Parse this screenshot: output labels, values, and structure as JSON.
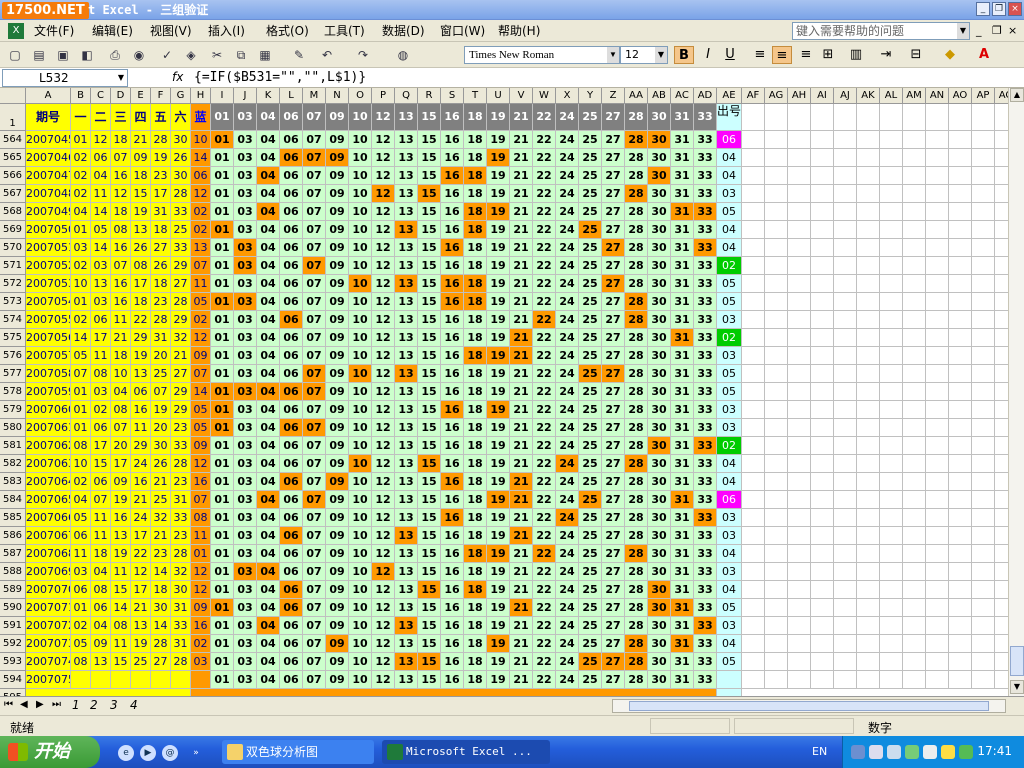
{
  "title": {
    "logo": "17500.NET",
    "text": "t Excel - 三组验证"
  },
  "menu": {
    "items": [
      "文件(F)",
      "编辑(E)",
      "视图(V)",
      "插入(I)",
      "格式(O)",
      "工具(T)",
      "数据(D)",
      "窗口(W)",
      "帮助(H)"
    ],
    "help_placeholder": "键入需要帮助的问题"
  },
  "toolbar": {
    "font": "Times New Roman",
    "size": "12"
  },
  "formula": {
    "cell": "L532",
    "fx": "fx",
    "text": "{=IF($B531=\"\",\"\",L$1)}"
  },
  "grid": {
    "cols": [
      "A",
      "B",
      "C",
      "D",
      "E",
      "F",
      "G",
      "H",
      "I",
      "J",
      "K",
      "L",
      "M",
      "N",
      "O",
      "P",
      "Q",
      "R",
      "S",
      "T",
      "U",
      "V",
      "W",
      "X",
      "Y",
      "Z",
      "AA",
      "AB",
      "AC",
      "AD",
      "AE",
      "AF",
      "AG",
      "AH",
      "AI",
      "AJ",
      "AK",
      "AL",
      "AM",
      "AN",
      "AO",
      "AP",
      "AQ"
    ],
    "header_row": {
      "num": "1",
      "a": "期号",
      "b": [
        "一",
        "二",
        "三",
        "四",
        "五",
        "六"
      ],
      "h": "蓝",
      "nums": [
        "01",
        "03",
        "04",
        "06",
        "07",
        "09",
        "10",
        "12",
        "13",
        "15",
        "16",
        "18",
        "19",
        "21",
        "22",
        "24",
        "25",
        "27",
        "28",
        "30",
        "31",
        "33"
      ],
      "ae": "出号"
    },
    "rows": [
      {
        "r": "564",
        "a": "2007045",
        "b": [
          "01",
          "12",
          "18",
          "21",
          "28",
          "30"
        ],
        "h": "10",
        "o": [
          "01",
          "28",
          "30"
        ],
        "ae": "06",
        "aec": "m"
      },
      {
        "r": "565",
        "a": "2007046",
        "b": [
          "02",
          "06",
          "07",
          "09",
          "19",
          "26"
        ],
        "h": "14",
        "o": [
          "06",
          "07",
          "09",
          "19"
        ],
        "ae": "04",
        "aec": ""
      },
      {
        "r": "566",
        "a": "2007047",
        "b": [
          "02",
          "04",
          "16",
          "18",
          "23",
          "30"
        ],
        "h": "06",
        "o": [
          "04",
          "16",
          "18",
          "30"
        ],
        "ae": "04",
        "aec": ""
      },
      {
        "r": "567",
        "a": "2007048",
        "b": [
          "02",
          "11",
          "12",
          "15",
          "17",
          "28"
        ],
        "h": "12",
        "o": [
          "12",
          "15",
          "28"
        ],
        "ae": "03",
        "aec": ""
      },
      {
        "r": "568",
        "a": "2007049",
        "b": [
          "04",
          "14",
          "18",
          "19",
          "31",
          "33"
        ],
        "h": "02",
        "o": [
          "04",
          "18",
          "19",
          "31",
          "33"
        ],
        "ae": "05",
        "aec": ""
      },
      {
        "r": "569",
        "a": "2007050",
        "b": [
          "01",
          "05",
          "08",
          "13",
          "18",
          "25"
        ],
        "h": "02",
        "o": [
          "01",
          "13",
          "18",
          "25"
        ],
        "ae": "04",
        "aec": ""
      },
      {
        "r": "570",
        "a": "2007051",
        "b": [
          "03",
          "14",
          "16",
          "26",
          "27",
          "33"
        ],
        "h": "13",
        "o": [
          "03",
          "16",
          "27",
          "33"
        ],
        "ae": "04",
        "aec": ""
      },
      {
        "r": "571",
        "a": "2007052",
        "b": [
          "02",
          "03",
          "07",
          "08",
          "26",
          "29"
        ],
        "h": "07",
        "o": [
          "03",
          "07"
        ],
        "ae": "02",
        "aec": "g"
      },
      {
        "r": "572",
        "a": "2007053",
        "b": [
          "10",
          "13",
          "16",
          "17",
          "18",
          "27"
        ],
        "h": "11",
        "o": [
          "10",
          "13",
          "16",
          "18",
          "27"
        ],
        "ae": "05",
        "aec": ""
      },
      {
        "r": "573",
        "a": "2007054",
        "b": [
          "01",
          "03",
          "16",
          "18",
          "23",
          "28"
        ],
        "h": "05",
        "o": [
          "01",
          "03",
          "16",
          "18",
          "28"
        ],
        "ae": "05",
        "aec": ""
      },
      {
        "r": "574",
        "a": "2007055",
        "b": [
          "02",
          "06",
          "11",
          "22",
          "28",
          "29"
        ],
        "h": "02",
        "o": [
          "06",
          "22",
          "28"
        ],
        "ae": "03",
        "aec": ""
      },
      {
        "r": "575",
        "a": "2007056",
        "b": [
          "14",
          "17",
          "21",
          "29",
          "31",
          "32"
        ],
        "h": "12",
        "o": [
          "21",
          "31"
        ],
        "ae": "02",
        "aec": "g"
      },
      {
        "r": "576",
        "a": "2007057",
        "b": [
          "05",
          "11",
          "18",
          "19",
          "20",
          "21"
        ],
        "h": "09",
        "o": [
          "18",
          "19",
          "21"
        ],
        "ae": "03",
        "aec": ""
      },
      {
        "r": "577",
        "a": "2007058",
        "b": [
          "07",
          "08",
          "10",
          "13",
          "25",
          "27"
        ],
        "h": "07",
        "o": [
          "07",
          "10",
          "13",
          "25",
          "27"
        ],
        "ae": "05",
        "aec": ""
      },
      {
        "r": "578",
        "a": "2007059",
        "b": [
          "01",
          "03",
          "04",
          "06",
          "07",
          "29"
        ],
        "h": "14",
        "o": [
          "01",
          "03",
          "04",
          "06",
          "07"
        ],
        "ae": "05",
        "aec": ""
      },
      {
        "r": "579",
        "a": "2007060",
        "b": [
          "01",
          "02",
          "08",
          "16",
          "19",
          "29"
        ],
        "h": "05",
        "o": [
          "01",
          "16",
          "19"
        ],
        "ae": "03",
        "aec": ""
      },
      {
        "r": "580",
        "a": "2007061",
        "b": [
          "01",
          "06",
          "07",
          "11",
          "20",
          "23"
        ],
        "h": "05",
        "o": [
          "01",
          "06",
          "07"
        ],
        "ae": "03",
        "aec": ""
      },
      {
        "r": "581",
        "a": "2007062",
        "b": [
          "08",
          "17",
          "20",
          "29",
          "30",
          "33"
        ],
        "h": "09",
        "o": [
          "30",
          "33"
        ],
        "ae": "02",
        "aec": "g"
      },
      {
        "r": "582",
        "a": "2007063",
        "b": [
          "10",
          "15",
          "17",
          "24",
          "26",
          "28"
        ],
        "h": "12",
        "o": [
          "10",
          "15",
          "24",
          "28"
        ],
        "ae": "04",
        "aec": ""
      },
      {
        "r": "583",
        "a": "2007064",
        "b": [
          "02",
          "06",
          "09",
          "16",
          "21",
          "23"
        ],
        "h": "16",
        "o": [
          "06",
          "09",
          "16",
          "21"
        ],
        "ae": "04",
        "aec": ""
      },
      {
        "r": "584",
        "a": "2007065",
        "b": [
          "04",
          "07",
          "19",
          "21",
          "25",
          "31"
        ],
        "h": "07",
        "o": [
          "04",
          "07",
          "19",
          "21",
          "25",
          "31"
        ],
        "ae": "06",
        "aec": "m"
      },
      {
        "r": "585",
        "a": "2007066",
        "b": [
          "05",
          "11",
          "16",
          "24",
          "32",
          "33"
        ],
        "h": "08",
        "o": [
          "16",
          "24",
          "33"
        ],
        "ae": "03",
        "aec": ""
      },
      {
        "r": "586",
        "a": "2007067",
        "b": [
          "06",
          "11",
          "13",
          "17",
          "21",
          "23"
        ],
        "h": "11",
        "o": [
          "06",
          "13",
          "21"
        ],
        "ae": "03",
        "aec": ""
      },
      {
        "r": "587",
        "a": "2007068",
        "b": [
          "11",
          "18",
          "19",
          "22",
          "23",
          "28"
        ],
        "h": "01",
        "o": [
          "18",
          "19",
          "22",
          "28"
        ],
        "ae": "04",
        "aec": ""
      },
      {
        "r": "588",
        "a": "2007069",
        "b": [
          "03",
          "04",
          "11",
          "12",
          "14",
          "32"
        ],
        "h": "12",
        "o": [
          "03",
          "04",
          "12"
        ],
        "ae": "03",
        "aec": ""
      },
      {
        "r": "589",
        "a": "2007070",
        "b": [
          "06",
          "08",
          "15",
          "17",
          "18",
          "30"
        ],
        "h": "12",
        "o": [
          "06",
          "15",
          "18",
          "30"
        ],
        "ae": "04",
        "aec": ""
      },
      {
        "r": "590",
        "a": "2007071",
        "b": [
          "01",
          "06",
          "14",
          "21",
          "30",
          "31"
        ],
        "h": "09",
        "o": [
          "01",
          "06",
          "21",
          "30",
          "31"
        ],
        "ae": "05",
        "aec": ""
      },
      {
        "r": "591",
        "a": "2007072",
        "b": [
          "02",
          "04",
          "08",
          "13",
          "14",
          "33"
        ],
        "h": "16",
        "o": [
          "04",
          "13",
          "33"
        ],
        "ae": "03",
        "aec": ""
      },
      {
        "r": "592",
        "a": "2007073",
        "b": [
          "05",
          "09",
          "11",
          "19",
          "28",
          "31"
        ],
        "h": "02",
        "o": [
          "09",
          "19",
          "28",
          "31"
        ],
        "ae": "04",
        "aec": ""
      },
      {
        "r": "593",
        "a": "2007074",
        "b": [
          "08",
          "13",
          "15",
          "25",
          "27",
          "28"
        ],
        "h": "03",
        "o": [
          "13",
          "15",
          "25",
          "27",
          "28"
        ],
        "ae": "05",
        "aec": ""
      },
      {
        "r": "594",
        "a": "2007075",
        "b": [
          "",
          "",
          "",
          "",
          "",
          ""
        ],
        "h": "",
        "o": [],
        "ae": "",
        "aec": ""
      }
    ],
    "partial_row": "595"
  },
  "tabs": [
    "1",
    "2",
    "3",
    "4"
  ],
  "status": {
    "ready": "就绪",
    "mode": "数字"
  },
  "taskbar": {
    "start": "开始",
    "tasks": [
      "双色球分析图",
      "Microsoft Excel ..."
    ],
    "lang": "EN",
    "clock": "17:41"
  },
  "colors": {
    "yellow": "#ffff00",
    "orange": "#ff9900",
    "lightgreen": "#ccffcc",
    "teal": "#ccffff",
    "header_gray": "#808080",
    "magenta": "#ff00ff",
    "green": "#00cc00",
    "blue_text": "#0000ff",
    "dark_text": "#000080"
  }
}
